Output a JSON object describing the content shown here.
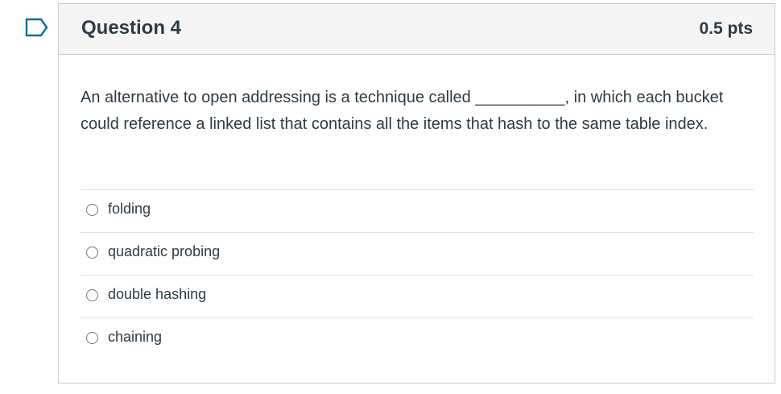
{
  "question": {
    "title": "Question 4",
    "points": "0.5 pts",
    "text": "An alternative to open addressing is a technique called __________, in which each bucket could reference a linked list that contains all the items that hash to the same table index.",
    "answers": [
      {
        "label": "folding"
      },
      {
        "label": "quadratic probing"
      },
      {
        "label": "double hashing"
      },
      {
        "label": "chaining"
      }
    ]
  },
  "icons": {
    "flag": "flag-question-icon"
  },
  "colors": {
    "flag_stroke": "#0770a3",
    "text": "#2d3b45",
    "border": "#c7cdd1",
    "header_bg": "#f5f5f5"
  }
}
